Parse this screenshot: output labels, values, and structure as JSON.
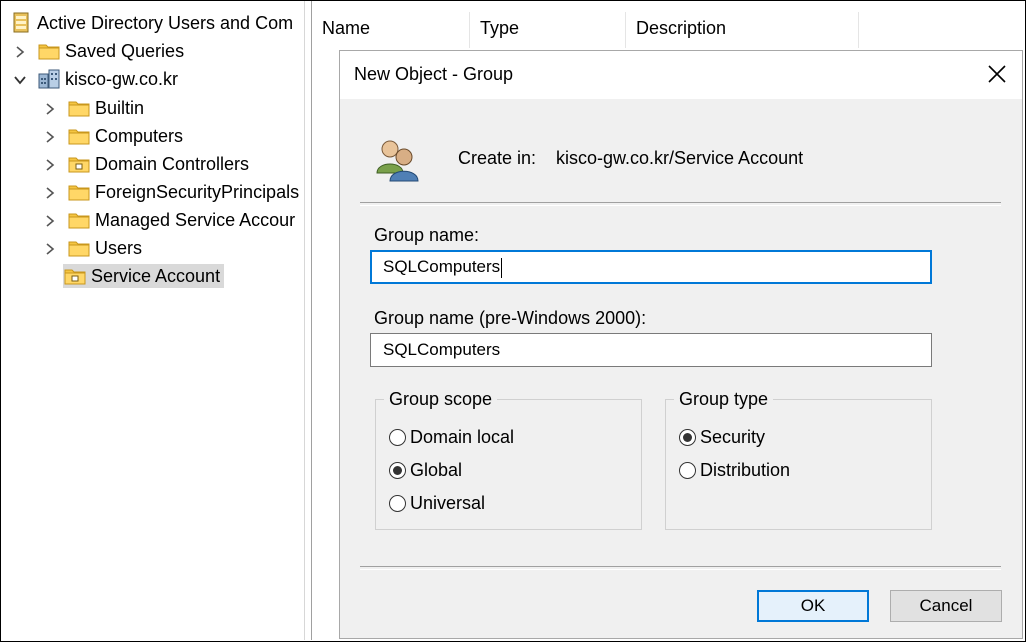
{
  "tree": {
    "root_label": "Active Directory Users and Com",
    "items": [
      {
        "label": "Saved Queries"
      },
      {
        "label": "kisco-gw.co.kr"
      },
      {
        "label": "Builtin"
      },
      {
        "label": "Computers"
      },
      {
        "label": "Domain Controllers"
      },
      {
        "label": "ForeignSecurityPrincipals"
      },
      {
        "label": "Managed Service Accour"
      },
      {
        "label": "Users"
      },
      {
        "label": "Service Account"
      }
    ]
  },
  "list": {
    "columns": [
      "Name",
      "Type",
      "Description"
    ]
  },
  "dialog": {
    "title": "New Object - Group",
    "create_in_label": "Create in:",
    "create_in_path": "kisco-gw.co.kr/Service Account",
    "group_name_label": "Group name:",
    "group_name_value": "SQLComputers",
    "pre2000_label": "Group name (pre-Windows 2000):",
    "pre2000_value": "SQLComputers",
    "scope": {
      "legend": "Group scope",
      "options": [
        "Domain local",
        "Global",
        "Universal"
      ],
      "selected": "Global"
    },
    "type": {
      "legend": "Group type",
      "options": [
        "Security",
        "Distribution"
      ],
      "selected": "Security"
    },
    "ok_label": "OK",
    "cancel_label": "Cancel"
  },
  "colors": {
    "focus_accent": "#0078d7",
    "dialog_bg": "#f0f0f0",
    "folder_yellow": "#f5c542"
  }
}
